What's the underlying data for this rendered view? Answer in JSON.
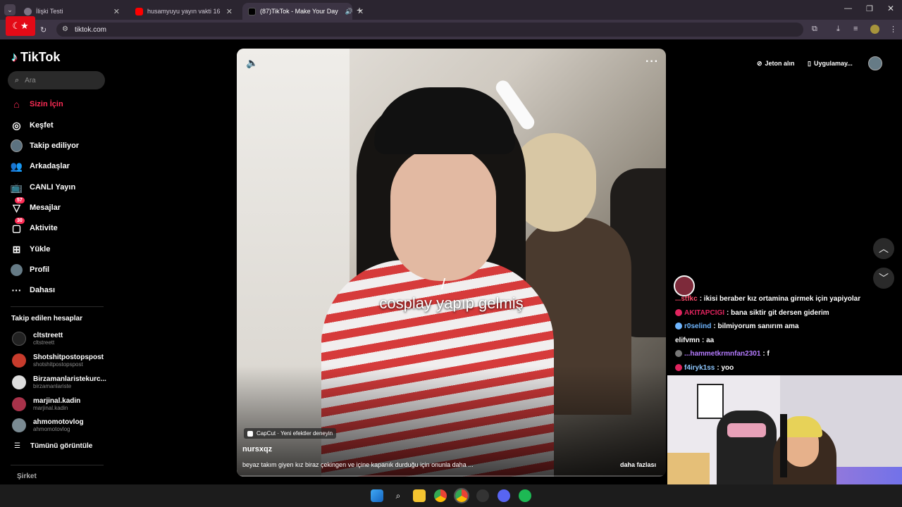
{
  "browser": {
    "tabs": [
      {
        "title": "İlişki Testi",
        "active": false
      },
      {
        "title": "husamyuyu yayın vakti 16 - You",
        "active": false
      },
      {
        "title": "(87)TikTok - Make Your Day",
        "active": true
      }
    ],
    "url": "tiktok.com"
  },
  "brand": {
    "name": "TikTok"
  },
  "search": {
    "placeholder": "Ara"
  },
  "nav": [
    {
      "label": "Sizin İçin",
      "icon": "home-icon",
      "active": true
    },
    {
      "label": "Keşfet",
      "icon": "compass-icon"
    },
    {
      "label": "Takip ediliyor",
      "icon": "following-avatar-icon"
    },
    {
      "label": "Arkadaşlar",
      "icon": "friends-icon"
    },
    {
      "label": "CANLI Yayın",
      "icon": "live-tv-icon"
    },
    {
      "label": "Mesajlar",
      "icon": "messages-icon",
      "badge": "57"
    },
    {
      "label": "Aktivite",
      "icon": "activity-icon",
      "badge": "30"
    },
    {
      "label": "Yükle",
      "icon": "upload-icon"
    },
    {
      "label": "Profil",
      "icon": "profile-avatar-icon"
    },
    {
      "label": "Dahası",
      "icon": "more-dots-icon"
    }
  ],
  "following": {
    "title": "Takip edilen hesaplar",
    "accounts": [
      {
        "name": "cltstreett",
        "handle": "cltstreett"
      },
      {
        "name": "Shotshitpostopspost",
        "handle": "shotshitpostopspost"
      },
      {
        "name": "Birzamanlaristekurc...",
        "handle": "birzamanlariste"
      },
      {
        "name": "marjinal.kadin",
        "handle": "marjinal.kadin"
      },
      {
        "name": "ahmomotovlog",
        "handle": "ahmomotovlog"
      }
    ],
    "see_all": "Tümünü görüntüle"
  },
  "footer": {
    "company": "Şirket"
  },
  "video": {
    "caption_slash": "/",
    "caption": "cosplay yapıp gelmiş",
    "capcut_label": "CapCut · Yeni efektler deneyin",
    "author": "nursxqz",
    "description": "beyaz takım giyen kız biraz çekingen ve içine kapanık durduğu için onunla daha ...",
    "more_label": "daha fazlası"
  },
  "top_right": {
    "coins_label": "Jeton alın",
    "app_label": "Uygulamay..."
  },
  "chat": [
    {
      "user": "...stfkc",
      "message": "ikisi beraber kız ortamina girmek için yapiyolar",
      "color": "#ff4d6d"
    },
    {
      "user": "AKITAPCIGI",
      "message": "bana siktir git dersen giderim",
      "color": "#e0245e"
    },
    {
      "user": "r0selind",
      "message": "bilmiyorum sanırım ama",
      "color": "#6fb6ff"
    },
    {
      "user": "elifvmn",
      "message": "aa",
      "color": "#ffffff"
    },
    {
      "user": "...hammetkrmnfan2301",
      "message": "f",
      "color": "#b57bff"
    },
    {
      "user": "f4iryk1ss",
      "message": "yoo",
      "color": "#8ec7ff"
    }
  ],
  "taskbar": [
    "windows-start-icon",
    "search-icon",
    "file-explorer-icon",
    "chrome-icon",
    "chrome-active-icon",
    "github-icon",
    "discord-icon",
    "spotify-icon"
  ],
  "colors": {
    "accent": "#fe2c55",
    "bg": "#000000",
    "chrome": "#3c3444"
  }
}
